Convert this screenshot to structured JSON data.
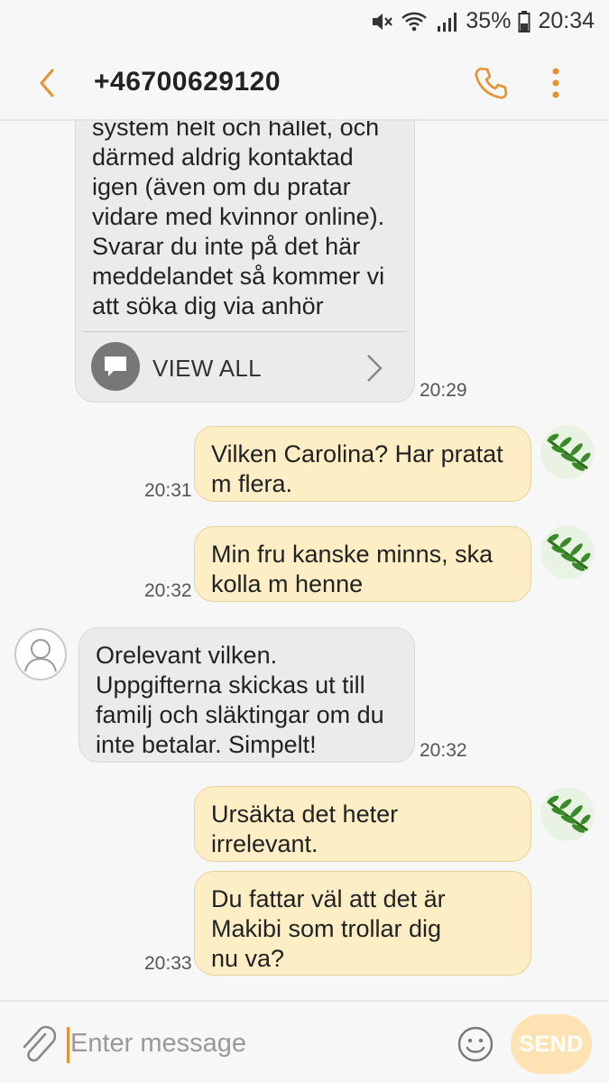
{
  "status_bar": {
    "battery": "35%",
    "time": "20:34"
  },
  "header": {
    "contact": "+46700629120",
    "accent_color": "#e8912f"
  },
  "messages": [
    {
      "direction": "incoming",
      "text": "system helt och hållet, och\ndärmed aldrig kontaktad\nigen (även om du pratar\nvidare med kvinnor online).\nSvarar du inte på det här\nmeddelandet så kommer vi\natt söka dig via anhör",
      "action_label": "VIEW ALL",
      "time": "20:29"
    },
    {
      "direction": "outgoing",
      "text": "Vilken Carolina? Har pratat\nm flera.",
      "time": "20:31"
    },
    {
      "direction": "outgoing",
      "text": "Min fru kanske minns, ska\nkolla m henne",
      "time": "20:32"
    },
    {
      "direction": "incoming",
      "text": "Orelevant vilken.\nUppgifterna skickas ut till\nfamilj och släktingar om du\ninte betalar. Simpelt!",
      "time": "20:32"
    },
    {
      "direction": "outgoing",
      "text": "Ursäkta det heter\nirrelevant.",
      "time": ""
    },
    {
      "direction": "outgoing",
      "text": "Du fattar väl att det är\nMakibi som trollar dig\nnu va?",
      "time": "20:33"
    }
  ],
  "composer": {
    "placeholder": "Enter message",
    "send_label": "SEND"
  },
  "colors": {
    "outgoing_bubble": "#fdeec6",
    "incoming_bubble": "#ebebeb",
    "send_button": "#fde3b3"
  }
}
